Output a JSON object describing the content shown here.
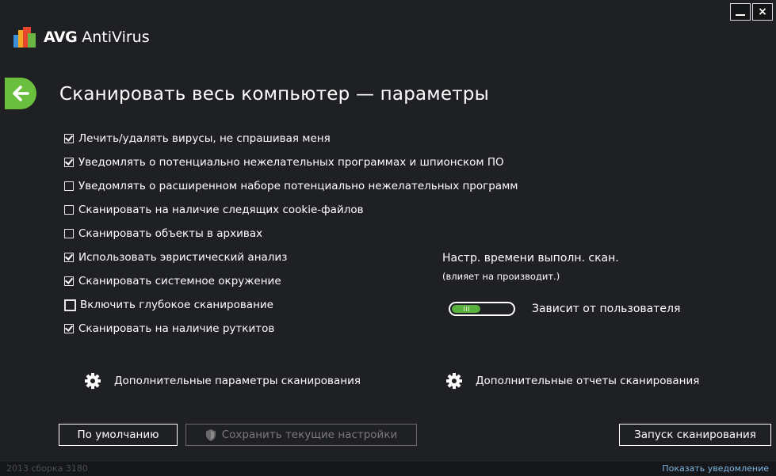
{
  "window": {
    "minimize_label": "—",
    "close_label": "×"
  },
  "logo": {
    "brand": "AVG",
    "product": "AntiVirus"
  },
  "page": {
    "title": "Сканировать весь компьютер — параметры"
  },
  "options": [
    {
      "label": "Лечить/удалять вирусы, не спрашивая меня",
      "checked": true
    },
    {
      "label": "Уведомлять о потенциально нежелательных программах и шпионском ПО",
      "checked": true
    },
    {
      "label": "Уведомлять о расширенном наборе потенциально нежелательных программ",
      "checked": false
    },
    {
      "label": "Сканировать на наличие следящих cookie-файлов",
      "checked": false
    },
    {
      "label": "Сканировать объекты в архивах",
      "checked": false
    },
    {
      "label": "Использовать эвристический анализ",
      "checked": true
    },
    {
      "label": "Сканировать системное окружение",
      "checked": true
    },
    {
      "label": "Включить глубокое сканирование",
      "checked": false
    },
    {
      "label": "Сканировать на наличие руткитов",
      "checked": true
    }
  ],
  "scan_time": {
    "title": "Настр. времени выполн. скан.",
    "subtitle": "(влияет на производит.)",
    "value_label": "Зависит от пользователя",
    "level": 0
  },
  "links": {
    "advanced_params": "Дополнительные параметры сканирования",
    "advanced_reports": "Дополнительные отчеты сканирования"
  },
  "buttons": {
    "default": "По умолчанию",
    "save": "Сохранить текущие настройки",
    "start": "Запуск сканирования"
  },
  "statusbar": {
    "version": "2013  сборка 3180",
    "notify": "Показать уведомление"
  },
  "colors": {
    "background": "#1f2023",
    "accent_green": "#6bbf3f",
    "link_blue": "#7fb6e0"
  }
}
